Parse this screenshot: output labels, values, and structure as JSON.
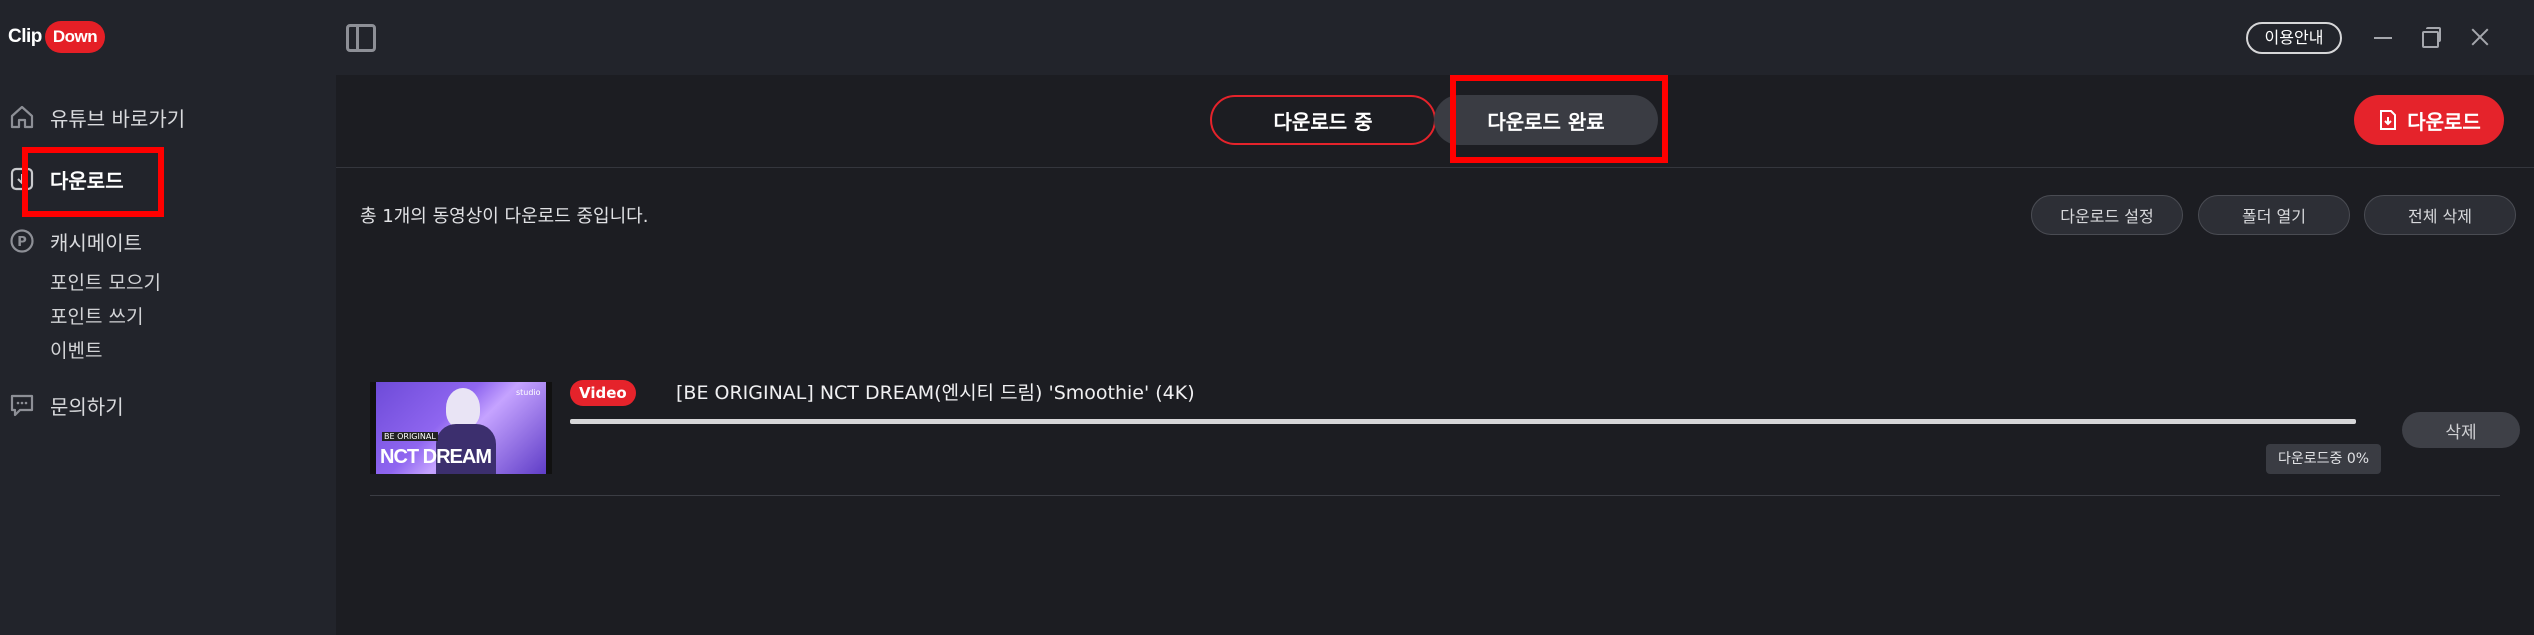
{
  "app": {
    "logo_clip": "Clip",
    "logo_down": "Down",
    "guide_label": "이용안내"
  },
  "sidebar": {
    "items": [
      {
        "label": "유튜브 바로가기",
        "icon": "home-icon"
      },
      {
        "label": "다운로드",
        "icon": "download-box-icon",
        "active": true
      },
      {
        "label": "캐시메이트",
        "icon": "point-circle-icon"
      },
      {
        "label": "문의하기",
        "icon": "chat-icon"
      }
    ],
    "sub_items": [
      "포인트 모으기",
      "포인트 쓰기",
      "이벤트"
    ]
  },
  "tabs": {
    "downloading": "다운로드 중",
    "complete": "다운로드 완료"
  },
  "download_cta": "다운로드",
  "status_text": "총 1개의 동영상이 다운로드 중입니다.",
  "actions": {
    "settings": "다운로드 설정",
    "open_folder": "폴더 열기",
    "delete_all": "전체 삭제"
  },
  "item": {
    "badge": "Video",
    "title": "[BE ORIGINAL] NCT DREAM(엔시티 드림) 'Smoothie' (4K)",
    "thumb_text": "NCT DREAM",
    "thumb_small": "BE ORIGINAL",
    "thumb_logo": "studio",
    "progress_fraction": 0.0,
    "progress_status": "다운로드중 0%",
    "delete_label": "삭제"
  },
  "colors": {
    "accent": "#e5232b",
    "highlight": "#ff0000",
    "sidebar_bg": "#22242b",
    "main_bg": "#1c1d22"
  }
}
